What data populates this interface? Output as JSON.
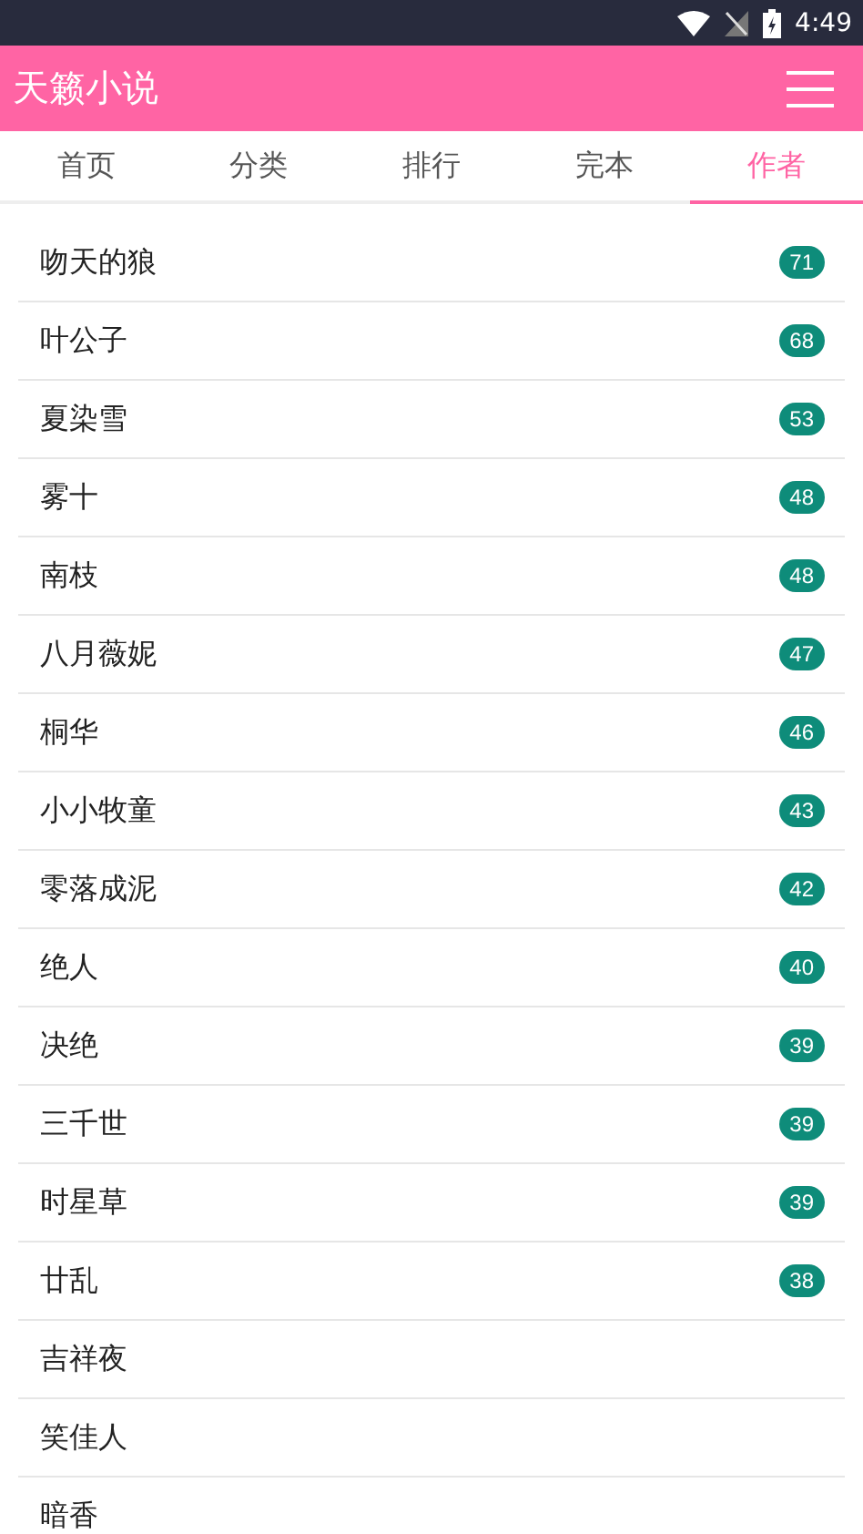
{
  "status_bar": {
    "time": "4:49"
  },
  "app_bar": {
    "title": "天籁小说"
  },
  "tabs": [
    {
      "label": "首页",
      "selected": false
    },
    {
      "label": "分类",
      "selected": false
    },
    {
      "label": "排行",
      "selected": false
    },
    {
      "label": "完本",
      "selected": false
    },
    {
      "label": "作者",
      "selected": true
    }
  ],
  "authors": [
    {
      "name": "吻天的狼",
      "count": "71"
    },
    {
      "name": "叶公子",
      "count": "68"
    },
    {
      "name": "夏染雪",
      "count": "53"
    },
    {
      "name": "雾十",
      "count": "48"
    },
    {
      "name": "南枝",
      "count": "48"
    },
    {
      "name": "八月薇妮",
      "count": "47"
    },
    {
      "name": "桐华",
      "count": "46"
    },
    {
      "name": "小小牧童",
      "count": "43"
    },
    {
      "name": "零落成泥",
      "count": "42"
    },
    {
      "name": "绝人",
      "count": "40"
    },
    {
      "name": "决绝",
      "count": "39"
    },
    {
      "name": "三千世",
      "count": "39"
    },
    {
      "name": "时星草",
      "count": "39"
    },
    {
      "name": "廿乱",
      "count": "38"
    },
    {
      "name": "吉祥夜"
    },
    {
      "name": "笑佳人"
    },
    {
      "name": "暗香"
    }
  ]
}
